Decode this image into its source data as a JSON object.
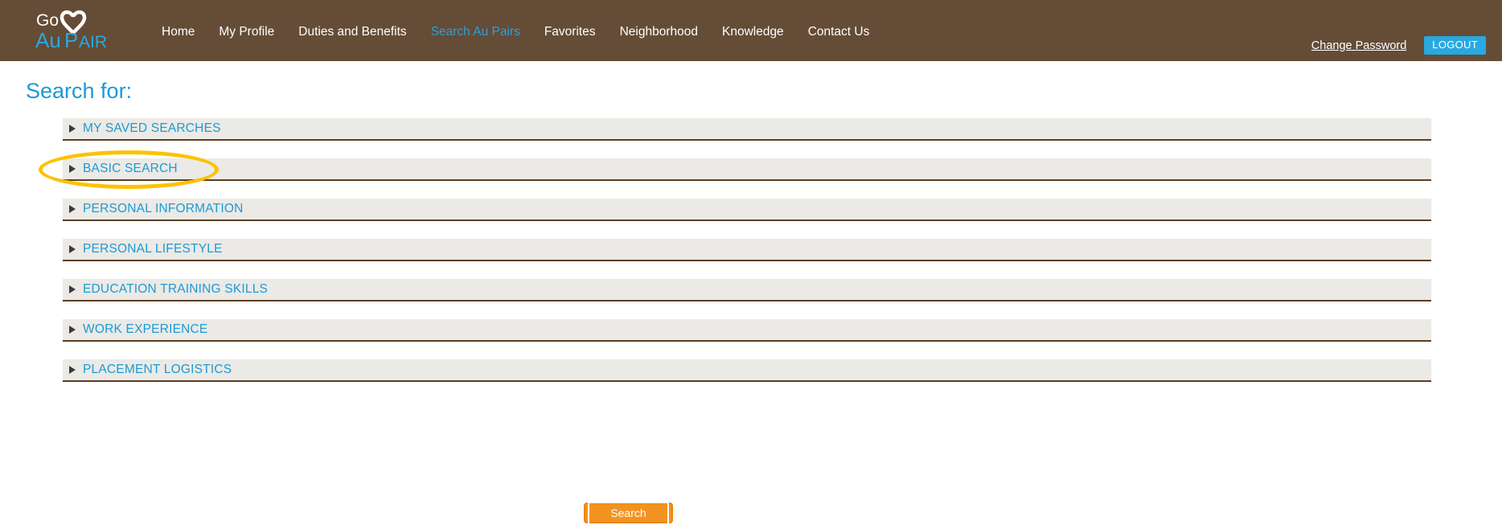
{
  "header": {
    "logo": {
      "line1": "Go",
      "line2_part1": "Au",
      "line2_part2": "Pair",
      "heart_icon": "heart-outline-icon",
      "color_white": "#ffffff",
      "color_blue": "#29a9e0"
    },
    "background_color": "#644c37",
    "nav": [
      {
        "label": "Home",
        "active": false
      },
      {
        "label": "My Profile",
        "active": false
      },
      {
        "label": "Duties and Benefits",
        "active": false
      },
      {
        "label": "Search Au Pairs",
        "active": true
      },
      {
        "label": "Favorites",
        "active": false
      },
      {
        "label": "Neighborhood",
        "active": false
      },
      {
        "label": "Knowledge",
        "active": false
      },
      {
        "label": "Contact Us",
        "active": false
      }
    ],
    "change_password_label": "Change Password",
    "logout_label": "LOGOUT",
    "logout_color": "#29a9e0"
  },
  "main": {
    "page_title": "Search for:",
    "title_color": "#1b9ad6",
    "accordion_background": "#ebeae6",
    "accordion_border_color": "#5c3d22",
    "sections": [
      {
        "label": "MY SAVED SEARCHES",
        "expanded": false
      },
      {
        "label": "BASIC SEARCH",
        "expanded": false
      },
      {
        "label": "PERSONAL INFORMATION",
        "expanded": false
      },
      {
        "label": "PERSONAL LIFESTYLE",
        "expanded": false
      },
      {
        "label": "EDUCATION TRAINING SKILLS",
        "expanded": false
      },
      {
        "label": "WORK EXPERIENCE",
        "expanded": false
      },
      {
        "label": "PLACEMENT LOGISTICS",
        "expanded": false
      }
    ],
    "search_button_label": "Search",
    "search_button_color": "#f3931f"
  },
  "annotation": {
    "target": "BASIC SEARCH",
    "shape": "ellipse",
    "color": "#fcc200"
  }
}
